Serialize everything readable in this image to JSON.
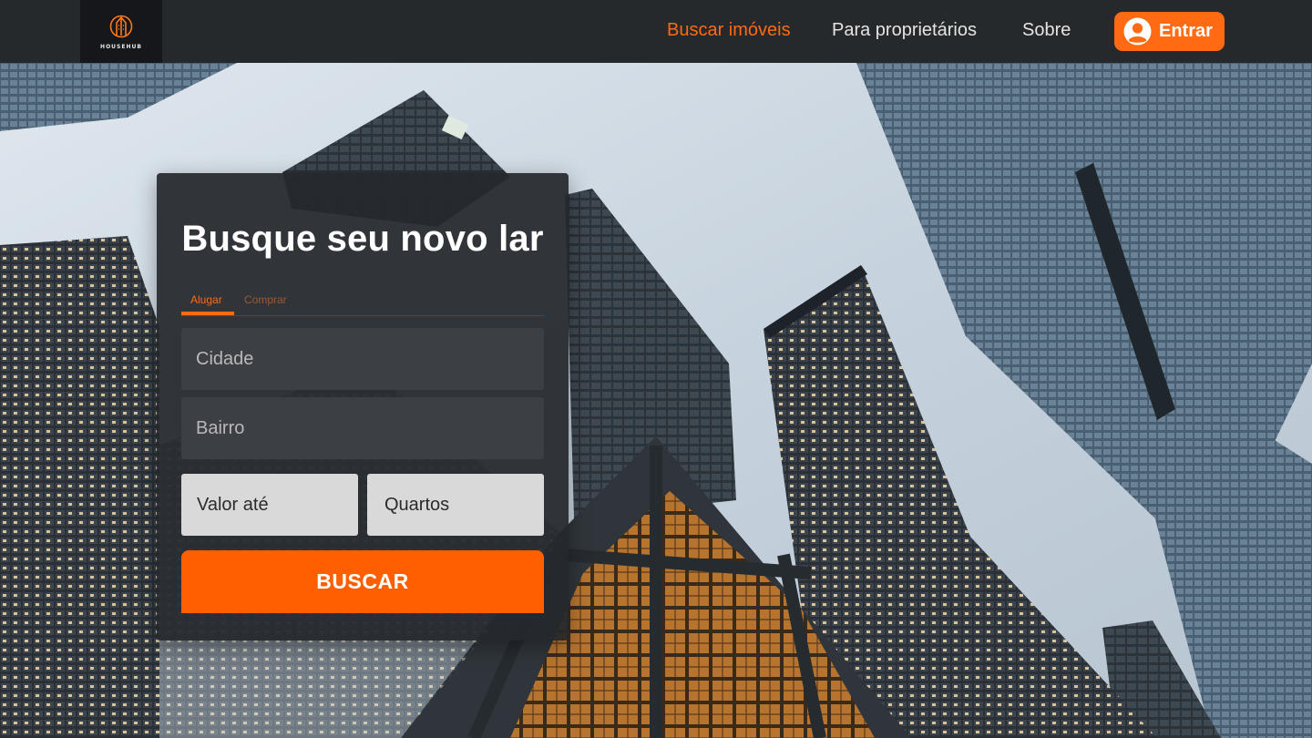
{
  "brand": {
    "name": "HOUSEHUB",
    "accent": "#ff6a12"
  },
  "nav": {
    "links": [
      {
        "label": "Buscar imóveis",
        "active": true
      },
      {
        "label": "Para proprietários",
        "active": false
      },
      {
        "label": "Sobre",
        "active": false
      }
    ],
    "login": {
      "label": "Entrar",
      "icon": "user-circle-icon"
    }
  },
  "search": {
    "title": "Busque seu novo lar",
    "tabs": [
      {
        "label": "Alugar",
        "active": true
      },
      {
        "label": "Comprar",
        "active": false
      }
    ],
    "fields": {
      "city_placeholder": "Cidade",
      "district_placeholder": "Bairro",
      "price_placeholder": "Valor até",
      "rooms_placeholder": "Quartos"
    },
    "submit_label": "BUSCAR"
  }
}
